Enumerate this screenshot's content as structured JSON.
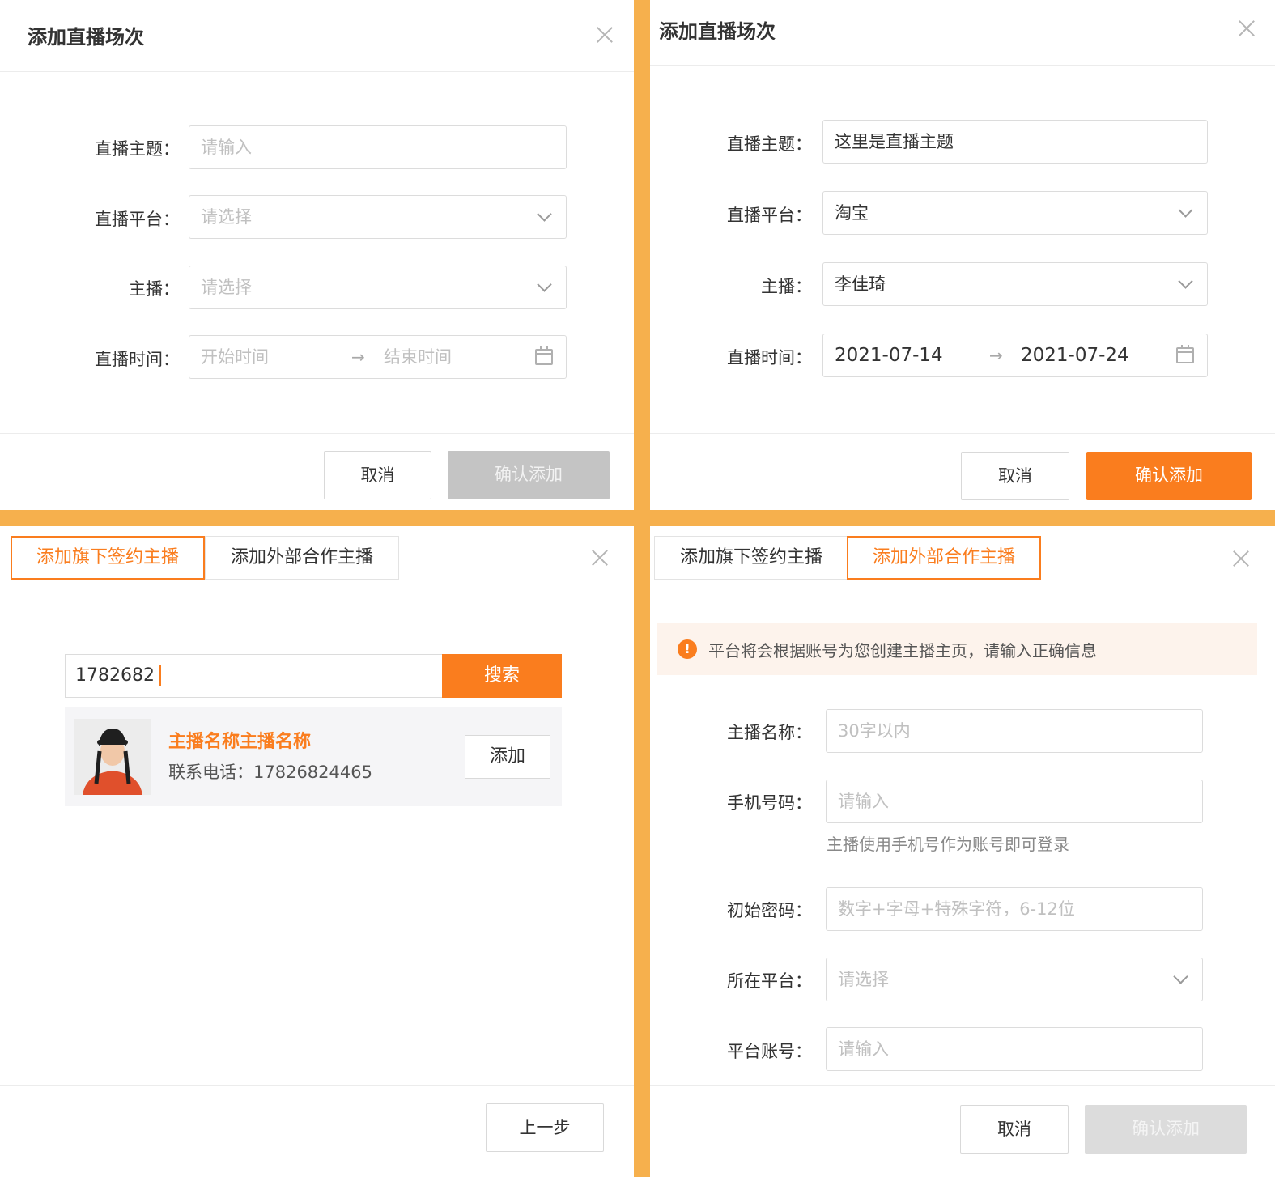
{
  "colors": {
    "accent": "#fa7d1e",
    "frame": "#f6b04d",
    "disabled": "#c4c4c4"
  },
  "panel1": {
    "title": "添加直播场次",
    "labels": {
      "topic": "直播主题：",
      "platform": "直播平台：",
      "anchor": "主播：",
      "time": "直播时间："
    },
    "topic_placeholder": "请输入",
    "platform_placeholder": "请选择",
    "anchor_placeholder": "请选择",
    "start_placeholder": "开始时间",
    "end_placeholder": "结束时间",
    "range_arrow": "→",
    "cancel_label": "取消",
    "confirm_label": "确认添加"
  },
  "panel2": {
    "title": "添加直播场次",
    "labels": {
      "topic": "直播主题：",
      "platform": "直播平台：",
      "anchor": "主播：",
      "time": "直播时间："
    },
    "topic_value": "这里是直播主题",
    "platform_value": "淘宝",
    "anchor_value": "李佳琦",
    "start_value": "2021-07-14",
    "end_value": "2021-07-24",
    "range_arrow": "→",
    "cancel_label": "取消",
    "confirm_label": "确认添加"
  },
  "panel3": {
    "tabs": [
      "添加旗下签约主播",
      "添加外部合作主播"
    ],
    "active_tab": 0,
    "search_value": "1782682",
    "search_button": "搜索",
    "result": {
      "name": "主播名称主播名称",
      "phone": "联系电话：17826824465",
      "add_label": "添加"
    },
    "prev_label": "上一步"
  },
  "panel4": {
    "tabs": [
      "添加旗下签约主播",
      "添加外部合作主播"
    ],
    "active_tab": 1,
    "notice_icon": "!",
    "notice": "平台将会根据账号为您创建主播主页，请输入正确信息",
    "labels": {
      "name": "主播名称：",
      "phone": "手机号码：",
      "password": "初始密码：",
      "platform": "所在平台：",
      "account": "平台账号："
    },
    "name_placeholder": "30字以内",
    "phone_placeholder": "请输入",
    "phone_hint": "主播使用手机号作为账号即可登录",
    "password_placeholder": "数字+字母+特殊字符，6-12位",
    "platform_placeholder": "请选择",
    "account_placeholder": "请输入",
    "cancel_label": "取消",
    "confirm_label": "确认添加"
  }
}
